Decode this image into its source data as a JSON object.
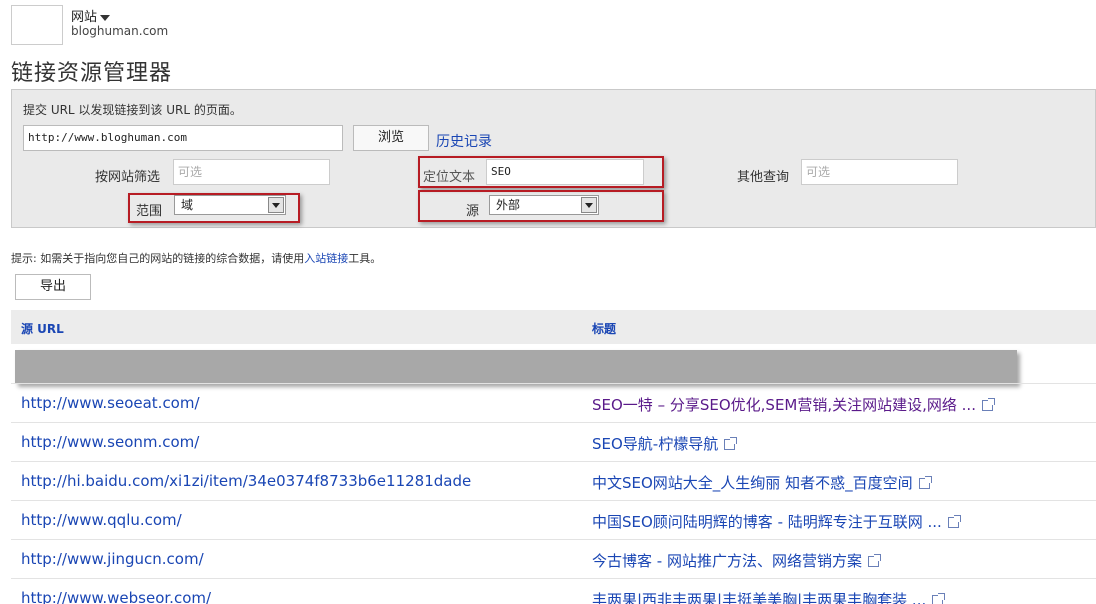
{
  "header": {
    "site_switcher": "网站",
    "site_domain": "bloghuman.com",
    "page_title": "链接资源管理器"
  },
  "query_panel": {
    "instruction": "提交 URL 以发现链接到该 URL 的页面。",
    "url_value": "http://www.bloghuman.com",
    "browse_label": "浏览",
    "history_label": "历史记录",
    "filter_by_site_label": "按网站筛选",
    "filter_by_site_placeholder": "可选",
    "anchor_text_label": "定位文本",
    "anchor_text_value": "SEO",
    "other_query_label": "其他查询",
    "other_query_placeholder": "可选",
    "scope_label": "范围",
    "scope_value": "域",
    "source_label": "源",
    "source_value": "外部"
  },
  "hint": {
    "prefix": "提示: 如需关于指向您自己的网站的链接的综合数据，请使用",
    "link": "入站链接",
    "suffix": "工具。"
  },
  "export_label": "导出",
  "table": {
    "headers": [
      "源 URL",
      "标题"
    ],
    "rows": [
      {
        "url": "http://www.seoeat.com/",
        "title": "SEO一特 – 分享SEO优化,SEM营销,关注网站建设,网络 ..."
      },
      {
        "url": "http://www.seonm.com/",
        "title": "SEO导航-柠檬导航"
      },
      {
        "url": "http://hi.baidu.com/xi1zi/item/34e0374f8733b6e11281dade",
        "title": "中文SEO网站大全_人生绚丽 知者不惑_百度空间"
      },
      {
        "url": "http://www.qqlu.com/",
        "title": "中国SEO顾问陆明辉的博客 - 陆明辉专注于互联网 ..."
      },
      {
        "url": "http://www.jingucn.com/",
        "title": "今古博客 - 网站推广方法、网络营销方案"
      },
      {
        "url": "http://www.webseor.com/",
        "title": "丰两果|西非丰两果|丰挺美美胸|丰两果丰胸套装 ..."
      }
    ]
  },
  "colors": {
    "link": "#1a46b4",
    "visited": "#5a1a8a",
    "highlight_box": "#b71c24",
    "panel_bg": "#eaeaea"
  }
}
